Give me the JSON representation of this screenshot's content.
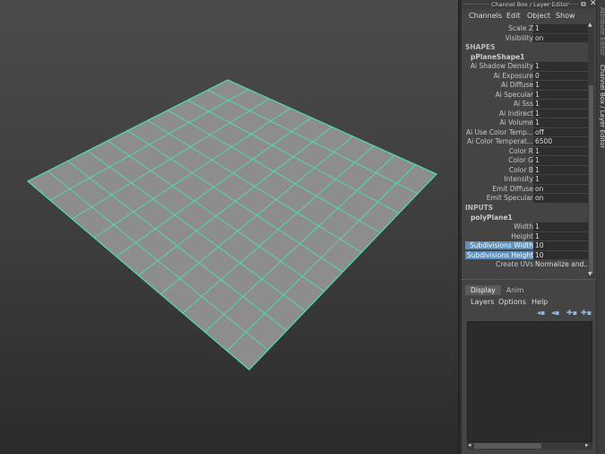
{
  "channel_box": {
    "title": "Channel Box / Layer Editor",
    "menu": [
      "Channels",
      "Edit",
      "Object",
      "Show"
    ],
    "top_rows": [
      {
        "label": "Scale Z",
        "value": "1"
      },
      {
        "label": "Visibility",
        "value": "on"
      }
    ],
    "shapes_header": "SHAPES",
    "shape_node": "pPlaneShape1",
    "shape_rows": [
      {
        "label": "Ai Shadow Density",
        "value": "1"
      },
      {
        "label": "Ai Exposure",
        "value": "0"
      },
      {
        "label": "Ai Diffuse",
        "value": "1"
      },
      {
        "label": "Ai Specular",
        "value": "1"
      },
      {
        "label": "Ai Sss",
        "value": "1"
      },
      {
        "label": "Ai Indirect",
        "value": "1"
      },
      {
        "label": "Ai Volume",
        "value": "1"
      },
      {
        "label": "Ai Use Color Temp...",
        "value": "off"
      },
      {
        "label": "Ai Color Temperat...",
        "value": "6500"
      },
      {
        "label": "Color R",
        "value": "1"
      },
      {
        "label": "Color G",
        "value": "1"
      },
      {
        "label": "Color B",
        "value": "1"
      },
      {
        "label": "Intensity",
        "value": "1"
      },
      {
        "label": "Emit Diffuse",
        "value": "on"
      },
      {
        "label": "Emit Specular",
        "value": "on"
      }
    ],
    "inputs_header": "INPUTS",
    "input_node": "polyPlane1",
    "input_rows": [
      {
        "label": "Width",
        "value": "1"
      },
      {
        "label": "Height",
        "value": "1"
      },
      {
        "label": "Subdivisions Width",
        "value": "10",
        "highlight": true
      },
      {
        "label": "Subdivisions Height",
        "value": "10",
        "highlight": true
      },
      {
        "label": "Create UVs",
        "value": "Normalize and..."
      }
    ]
  },
  "layer_editor": {
    "tabs": [
      "Display",
      "Anim"
    ],
    "menu": [
      "Layers",
      "Options",
      "Help"
    ],
    "icons": [
      "move-layer-up-icon",
      "move-layer-down-icon",
      "create-empty-layer-icon",
      "create-layer-from-selection-icon"
    ]
  },
  "side_tabs": [
    "Attribute Editor",
    "Channel Box / Layer Editor"
  ],
  "viewport": {
    "grid_divisions": 10,
    "plane_color": "#8d8d8d",
    "wire_color": "#4fe0a8"
  }
}
